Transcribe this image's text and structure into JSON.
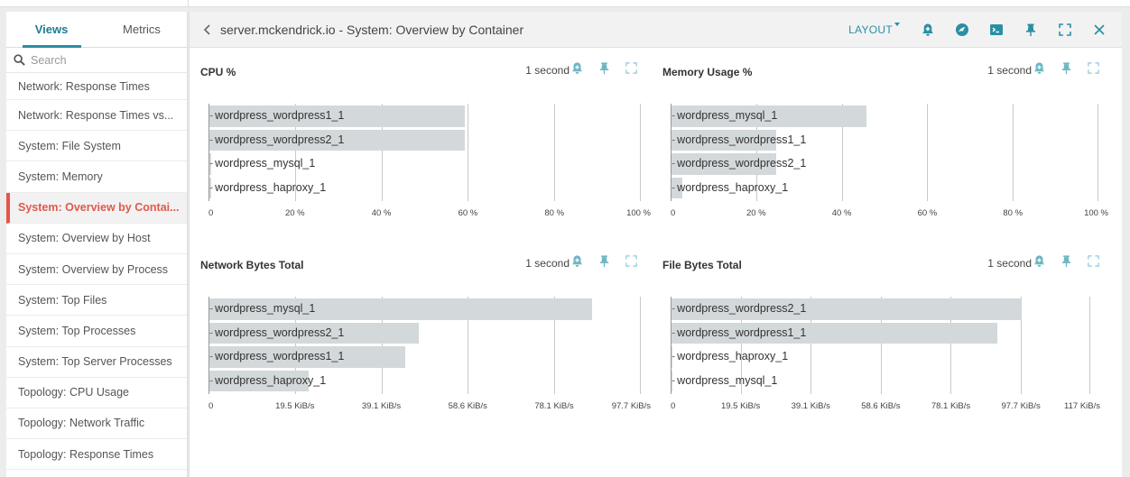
{
  "sidebar": {
    "tabs": [
      {
        "label": "Views",
        "active": true
      },
      {
        "label": "Metrics",
        "active": false
      }
    ],
    "search_placeholder": "Search",
    "items": [
      {
        "label": "Network: Response Times",
        "active": false
      },
      {
        "label": "Network: Response Times vs...",
        "active": false
      },
      {
        "label": "System: File System",
        "active": false
      },
      {
        "label": "System: Memory",
        "active": false
      },
      {
        "label": "System: Overview by Contai...",
        "active": true
      },
      {
        "label": "System: Overview by Host",
        "active": false
      },
      {
        "label": "System: Overview by Process",
        "active": false
      },
      {
        "label": "System: Top Files",
        "active": false
      },
      {
        "label": "System: Top Processes",
        "active": false
      },
      {
        "label": "System: Top Server Processes",
        "active": false
      },
      {
        "label": "Topology: CPU Usage",
        "active": false
      },
      {
        "label": "Topology: Network Traffic",
        "active": false
      },
      {
        "label": "Topology: Response Times",
        "active": false
      }
    ]
  },
  "header": {
    "title": "server.mckendrick.io - System: Overview by Container",
    "layout_label": "LAYOUT",
    "icons": [
      "alert-bell-icon",
      "sysdig-logo-icon",
      "terminal-icon",
      "pin-icon",
      "fullscreen-icon",
      "close-icon"
    ]
  },
  "colors": {
    "accent": "#2a8fa3",
    "active_nav": "#e05a4d",
    "bar": "#d3d8da"
  },
  "charts": [
    {
      "title": "CPU %",
      "interval": "1 second",
      "type": "bar",
      "orientation": "horizontal",
      "categories": [
        "wordpress_wordpress1_1",
        "wordpress_wordpress2_1",
        "wordpress_mysql_1",
        "wordpress_haproxy_1"
      ],
      "values": [
        59,
        59,
        0.5,
        0.5
      ],
      "unit": "%",
      "xlim": [
        0,
        100
      ],
      "ticks": [
        "0",
        "20 %",
        "40 %",
        "60 %",
        "80 %",
        "100 %"
      ]
    },
    {
      "title": "Memory Usage %",
      "interval": "1 second",
      "type": "bar",
      "orientation": "horizontal",
      "categories": [
        "wordpress_mysql_1",
        "wordpress_wordpress1_1",
        "wordpress_wordpress2_1",
        "wordpress_haproxy_1"
      ],
      "values": [
        45.5,
        24.5,
        24.5,
        2.5
      ],
      "unit": "%",
      "xlim": [
        0,
        100
      ],
      "ticks": [
        "0",
        "20 %",
        "40 %",
        "60 %",
        "80 %",
        "100 %"
      ]
    },
    {
      "title": "Network Bytes Total",
      "interval": "1 second",
      "type": "bar",
      "orientation": "horizontal",
      "categories": [
        "wordpress_mysql_1",
        "wordpress_wordpress2_1",
        "wordpress_wordpress1_1",
        "wordpress_haproxy_1"
      ],
      "values": [
        86.5,
        47.3,
        44.3,
        22.4
      ],
      "unit": "KiB/s",
      "xlim": [
        0,
        97.7
      ],
      "ticks": [
        "0",
        "19.5 KiB/s",
        "39.1 KiB/s",
        "58.6 KiB/s",
        "78.1 KiB/s",
        "97.7 KiB/s"
      ]
    },
    {
      "title": "File Bytes Total",
      "interval": "1 second",
      "type": "bar",
      "orientation": "horizontal",
      "categories": [
        "wordpress_wordpress2_1",
        "wordpress_wordpress1_1",
        "wordpress_haproxy_1",
        "wordpress_mysql_1"
      ],
      "values": [
        97.7,
        90.8,
        0.3,
        0.3
      ],
      "unit": "KiB/s",
      "xlim": [
        0,
        117
      ],
      "ticks": [
        "0",
        "19.5 KiB/s",
        "39.1 KiB/s",
        "58.6 KiB/s",
        "78.1 KiB/s",
        "97.7 KiB/s",
        "117 KiB/s"
      ]
    }
  ]
}
